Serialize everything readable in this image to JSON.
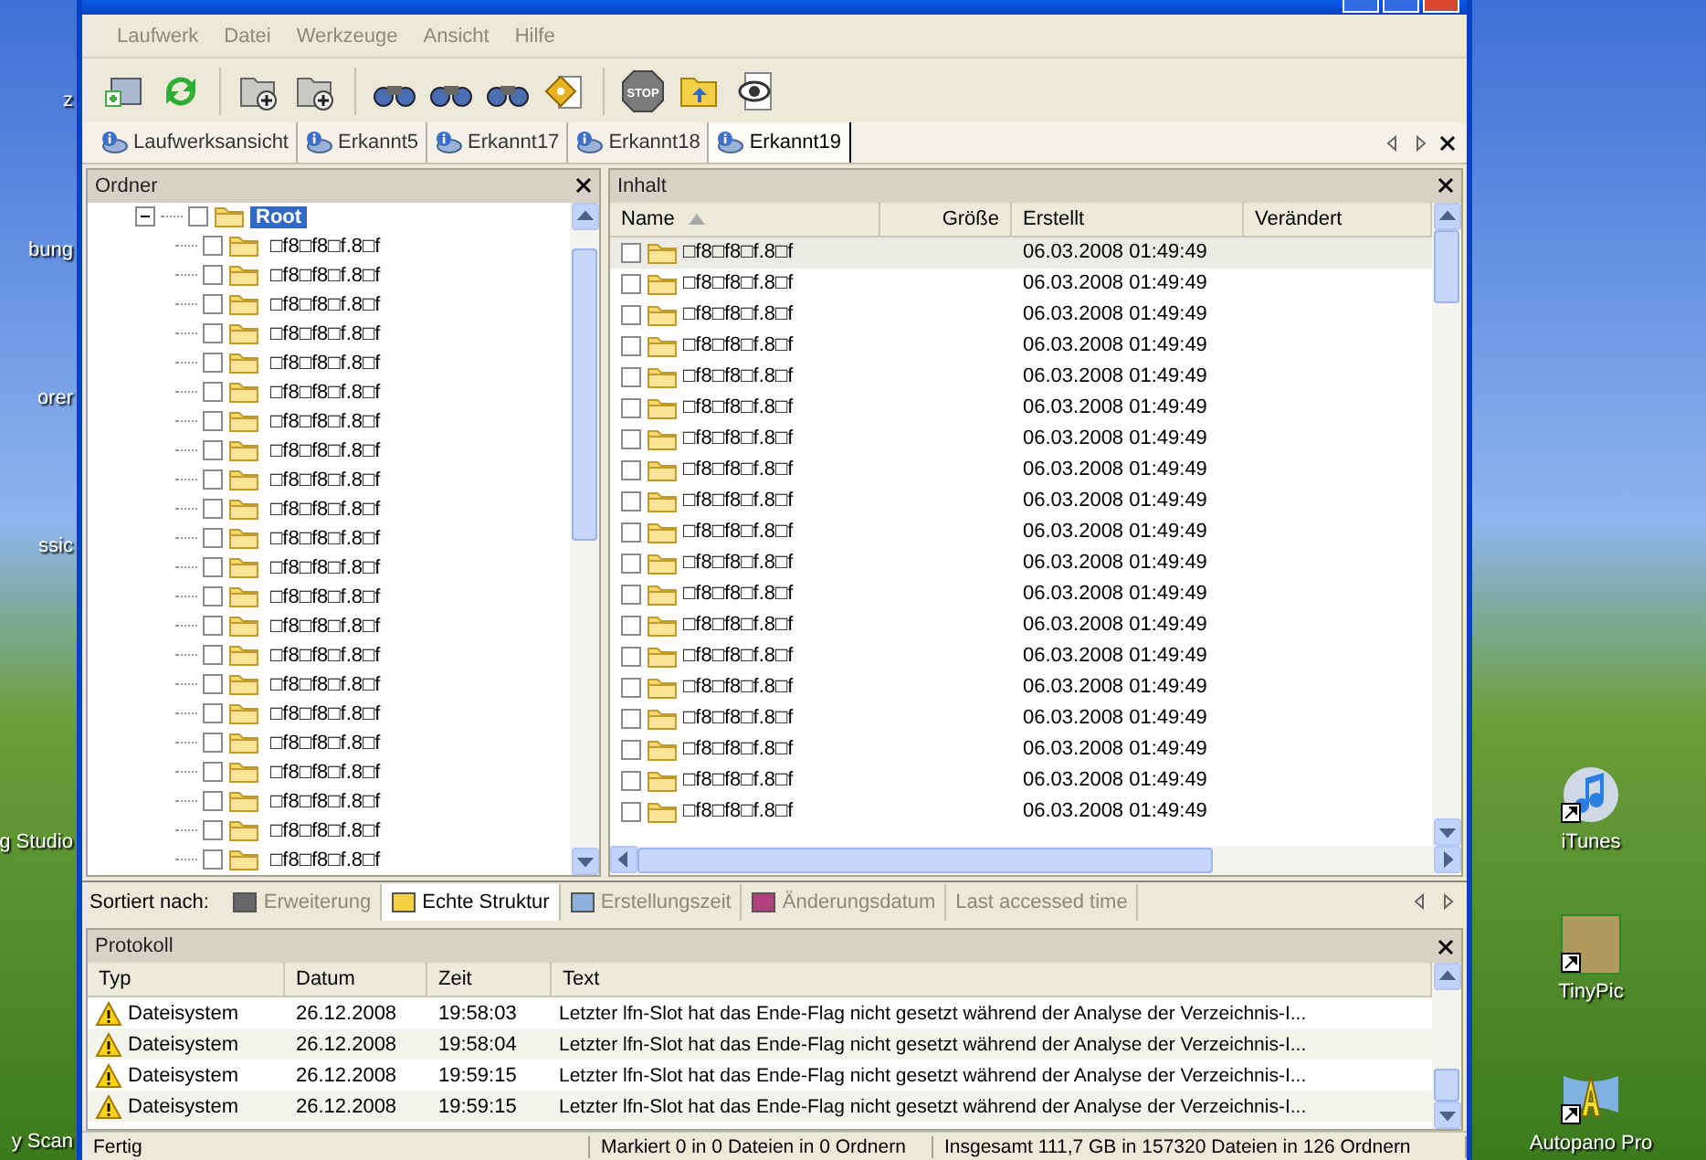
{
  "desktop": {
    "left_labels": [
      "z",
      "bung",
      "orer",
      "ssic",
      "g Studio",
      "y Scan"
    ],
    "right_icons": [
      {
        "label": "iTunes",
        "kind": "music"
      },
      {
        "label": "TinyPic",
        "kind": "picture"
      },
      {
        "label": "Autopano Pro",
        "kind": "panorama"
      }
    ]
  },
  "menu": [
    "Laufwerk",
    "Datei",
    "Werkzeuge",
    "Ansicht",
    "Hilfe"
  ],
  "toolbar": [
    {
      "kind": "drive"
    },
    {
      "kind": "refresh"
    },
    {
      "kind": "sep"
    },
    {
      "kind": "folder-add"
    },
    {
      "kind": "folder-add"
    },
    {
      "kind": "sep"
    },
    {
      "kind": "binoculars"
    },
    {
      "kind": "binoculars"
    },
    {
      "kind": "binoculars"
    },
    {
      "kind": "tag"
    },
    {
      "kind": "sep"
    },
    {
      "kind": "stop",
      "label": "STOP"
    },
    {
      "kind": "folder-up"
    },
    {
      "kind": "eye"
    }
  ],
  "tabs": [
    {
      "label": "Laufwerksansicht",
      "selected": false
    },
    {
      "label": "Erkannt5",
      "selected": false
    },
    {
      "label": "Erkannt17",
      "selected": false
    },
    {
      "label": "Erkannt18",
      "selected": false
    },
    {
      "label": "Erkannt19",
      "selected": true
    }
  ],
  "folders_panel": {
    "title": "Ordner",
    "root": {
      "label": "Root",
      "selected": true,
      "checked": false,
      "expanded": true,
      "children": [
        {
          "label": "□f8□f8□f.8□f",
          "checked": false
        },
        {
          "label": "□f8□f8□f.8□f",
          "checked": false
        },
        {
          "label": "□f8□f8□f.8□f",
          "checked": false
        },
        {
          "label": "□f8□f8□f.8□f",
          "checked": false
        },
        {
          "label": "□f8□f8□f.8□f",
          "checked": false
        },
        {
          "label": "□f8□f8□f.8□f",
          "checked": false
        },
        {
          "label": "□f8□f8□f.8□f",
          "checked": false
        },
        {
          "label": "□f8□f8□f.8□f",
          "checked": false
        },
        {
          "label": "□f8□f8□f.8□f",
          "checked": false
        },
        {
          "label": "□f8□f8□f.8□f",
          "checked": false
        },
        {
          "label": "□f8□f8□f.8□f",
          "checked": false
        },
        {
          "label": "□f8□f8□f.8□f",
          "checked": false
        },
        {
          "label": "□f8□f8□f.8□f",
          "checked": false
        },
        {
          "label": "□f8□f8□f.8□f",
          "checked": false
        },
        {
          "label": "□f8□f8□f.8□f",
          "checked": false
        },
        {
          "label": "□f8□f8□f.8□f",
          "checked": false
        },
        {
          "label": "□f8□f8□f.8□f",
          "checked": false
        },
        {
          "label": "□f8□f8□f.8□f",
          "checked": false
        },
        {
          "label": "□f8□f8□f.8□f",
          "checked": false
        },
        {
          "label": "□f8□f8□f.8□f",
          "checked": false
        },
        {
          "label": "□f8□f8□f.8□f",
          "checked": false
        },
        {
          "label": "□f8□f8□f.8□f",
          "checked": false
        }
      ]
    }
  },
  "content_panel": {
    "title": "Inhalt",
    "columns": [
      "Name",
      "Größe",
      "Erstellt",
      "Verändert"
    ],
    "rows": [
      {
        "name": "□f8□f8□f.8□f",
        "created": "06.03.2008 01:49:49",
        "selected": true,
        "checked": false
      },
      {
        "name": "□f8□f8□f.8□f",
        "created": "06.03.2008 01:49:49",
        "selected": false,
        "checked": false
      },
      {
        "name": "□f8□f8□f.8□f",
        "created": "06.03.2008 01:49:49",
        "selected": false,
        "checked": false
      },
      {
        "name": "□f8□f8□f.8□f",
        "created": "06.03.2008 01:49:49",
        "selected": false,
        "checked": false
      },
      {
        "name": "□f8□f8□f.8□f",
        "created": "06.03.2008 01:49:49",
        "selected": false,
        "checked": false
      },
      {
        "name": "□f8□f8□f.8□f",
        "created": "06.03.2008 01:49:49",
        "selected": false,
        "checked": false
      },
      {
        "name": "□f8□f8□f.8□f",
        "created": "06.03.2008 01:49:49",
        "selected": false,
        "checked": false
      },
      {
        "name": "□f8□f8□f.8□f",
        "created": "06.03.2008 01:49:49",
        "selected": false,
        "checked": false
      },
      {
        "name": "□f8□f8□f.8□f",
        "created": "06.03.2008 01:49:49",
        "selected": false,
        "checked": false
      },
      {
        "name": "□f8□f8□f.8□f",
        "created": "06.03.2008 01:49:49",
        "selected": false,
        "checked": false
      },
      {
        "name": "□f8□f8□f.8□f",
        "created": "06.03.2008 01:49:49",
        "selected": false,
        "checked": false
      },
      {
        "name": "□f8□f8□f.8□f",
        "created": "06.03.2008 01:49:49",
        "selected": false,
        "checked": false
      },
      {
        "name": "□f8□f8□f.8□f",
        "created": "06.03.2008 01:49:49",
        "selected": false,
        "checked": false
      },
      {
        "name": "□f8□f8□f.8□f",
        "created": "06.03.2008 01:49:49",
        "selected": false,
        "checked": false
      },
      {
        "name": "□f8□f8□f.8□f",
        "created": "06.03.2008 01:49:49",
        "selected": false,
        "checked": false
      },
      {
        "name": "□f8□f8□f.8□f",
        "created": "06.03.2008 01:49:49",
        "selected": false,
        "checked": false
      },
      {
        "name": "□f8□f8□f.8□f",
        "created": "06.03.2008 01:49:49",
        "selected": false,
        "checked": false
      },
      {
        "name": "□f8□f8□f.8□f",
        "created": "06.03.2008 01:49:49",
        "selected": false,
        "checked": false
      },
      {
        "name": "□f8□f8□f.8□f",
        "created": "06.03.2008 01:49:49",
        "selected": false,
        "checked": false
      }
    ]
  },
  "sort_bar": {
    "label": "Sortiert nach:",
    "options": [
      {
        "label": "Erweiterung",
        "selected": false
      },
      {
        "label": "Echte Struktur",
        "selected": true
      },
      {
        "label": "Erstellungszeit",
        "selected": false
      },
      {
        "label": "Änderungsdatum",
        "selected": false
      },
      {
        "label": "Last accessed time",
        "selected": false
      }
    ]
  },
  "log_panel": {
    "title": "Protokoll",
    "columns": [
      "Typ",
      "Datum",
      "Zeit",
      "Text"
    ],
    "rows": [
      {
        "kind": "warning",
        "type": "Dateisystem",
        "date": "26.12.2008",
        "time": "19:58:03",
        "text": "Letzter lfn-Slot hat das Ende-Flag nicht gesetzt während der Analyse der Verzeichnis-I..."
      },
      {
        "kind": "warning",
        "type": "Dateisystem",
        "date": "26.12.2008",
        "time": "19:58:04",
        "text": "Letzter lfn-Slot hat das Ende-Flag nicht gesetzt während der Analyse der Verzeichnis-I..."
      },
      {
        "kind": "warning",
        "type": "Dateisystem",
        "date": "26.12.2008",
        "time": "19:59:15",
        "text": "Letzter lfn-Slot hat das Ende-Flag nicht gesetzt während der Analyse der Verzeichnis-I..."
      },
      {
        "kind": "warning",
        "type": "Dateisystem",
        "date": "26.12.2008",
        "time": "19:59:15",
        "text": "Letzter lfn-Slot hat das Ende-Flag nicht gesetzt während der Analyse der Verzeichnis-I..."
      }
    ]
  },
  "status_bar": [
    "Fertig",
    "Markiert 0 in 0 Dateien in 0 Ordnern",
    "Insgesamt 111,7 GB in 157320 Dateien in 126 Ordnern"
  ]
}
